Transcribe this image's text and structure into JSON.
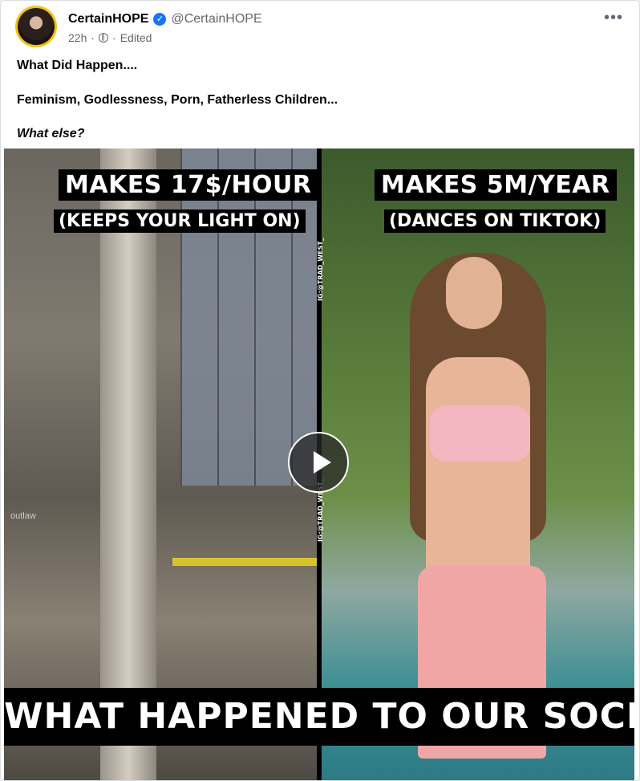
{
  "post": {
    "author": {
      "display_name": "CertainHOPE",
      "verified_icon": "check-badge-icon",
      "handle": "@CertainHOPE"
    },
    "meta": {
      "time": "22h",
      "separator": "·",
      "audience_icon": "globe-icon",
      "edited": "Edited"
    },
    "more_icon": "•••",
    "text": {
      "line1": "What Did Happen....",
      "line2": "Feminism, Godlessness, Porn, Fatherless Children...",
      "line3": "What else?"
    },
    "video": {
      "left_caption_1": "MAKES 17$/HOUR",
      "left_caption_2": "(KEEPS YOUR LIGHT ON)",
      "right_caption_1": "MAKES 5M/YEAR",
      "right_caption_2": "(DANCES ON TIKTOK)",
      "watermark_1": "IG:@TRAD_WEST_",
      "watermark_2": "IG:@TRAD_WEST_",
      "left_overlay": "outlaw",
      "bottom_banner": "WHAT HAPPENED TO OUR SOCIETY?",
      "play_icon": "play-icon"
    }
  },
  "colors": {
    "accent": "#1877f2",
    "avatar_ring": "#f4c20d",
    "muted_text": "#65676b"
  }
}
